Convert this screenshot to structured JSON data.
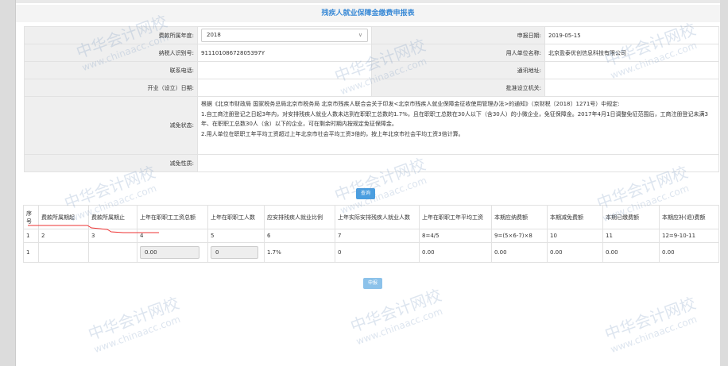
{
  "title": "残疾人就业保障金缴费申报表",
  "form": {
    "year_label": "费款所属年度:",
    "year_value": "2018",
    "date_label": "申报日期:",
    "date_value": "2019-05-15",
    "taxid_label": "纳税人识别号:",
    "taxid_value": "91110108672805397Y",
    "employer_label": "用人单位名称:",
    "employer_value": "北京盈泰优创信息科技有限公司",
    "phone_label": "联系电话:",
    "phone_value": "",
    "address_label": "通讯地址:",
    "address_value": "",
    "open_date_label": "开业（设立）日期:",
    "open_date_value": "",
    "approval_label": "批准设立机关:",
    "approval_value": "",
    "exempt_status_label": "减免状态:",
    "exempt_notes": [
      "根据《北京市财政局 国家税务总局北京市税务局 北京市残疾人联合会关于印发<北京市残疾人就业保障金征收使用管理办法>的通知》（京财税〔2018〕1271号）中规定:",
      "1.自工商注册登记之日起3年内，对安排残疾人就业人数未达到在职职工总数的1.7%，且在职职工总数在30人以下（含30人）的小微企业，免征保障金。2017年4月1日调整免征范围后，工商注册登记未满3年、在职职工总数30人（含）以下的企业，可在剩余时期内按规定免征保障金。",
      "2.用人单位在职职工年平均工资超过上年北京市社会平均工资3倍的，按上年北京市社会平均工资3倍计算。"
    ],
    "exempt_nature_label": "减免性质:",
    "exempt_nature_value": ""
  },
  "query_button": "查询",
  "submit_button": "申报",
  "table": {
    "headers": [
      "序号",
      "费款所属期起",
      "费款所属期止",
      "上年在职职工工资总额",
      "上年在职职工人数",
      "应安排残疾人就业比例",
      "上年实际安排残疾人就业人数",
      "上年在职职工年平均工资",
      "本期应纳费额",
      "本期减免费额",
      "本期已缴费额",
      "本期应补(退)费额"
    ],
    "index_row": [
      "1",
      "2",
      "3",
      "4",
      "5",
      "6",
      "7",
      "8=4/5",
      "9=(5×6-7)×8",
      "10",
      "11",
      "12=9-10-11"
    ],
    "data_row": {
      "seq": "1",
      "start": "",
      "end": "",
      "total_wage": "0.00",
      "staff_count": "0",
      "ratio": "1.7%",
      "actual_disabled": "0",
      "avg_wage": "0.00",
      "due": "0.00",
      "exempt": "0.00",
      "paid": "0.00",
      "balance": "0.00"
    }
  },
  "watermark": {
    "cn": "中华会计网校",
    "en": "www.chinaacc.com"
  }
}
